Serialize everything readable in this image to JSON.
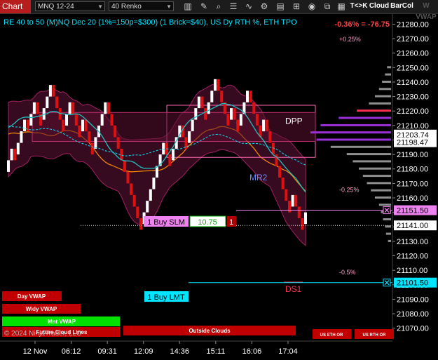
{
  "toolbar": {
    "chart_label": "Chart",
    "instrument": "MNQ 12-24",
    "bar_type": "40 Renko",
    "buttons": [
      "T<>K",
      "Cloud",
      "BarCol",
      "W VWAP"
    ],
    "colors": {
      "chart_tab": "#b81d1d",
      "t_k": "#ff8c00",
      "cloud": "#cc1f1f",
      "barcol": "#ff8c00",
      "wvwap": "#cfcfcf"
    }
  },
  "header": {
    "title": "RE 40 to 50 (M)NQ Dec 20 (1%=150p=$300) (1 Brick=$40), US Dy RTH %, ETH TPO",
    "change": "-0.36% = -76.75"
  },
  "price_axis": {
    "ticks": [
      "21280.00",
      "21270.00",
      "21260.00",
      "21250.00",
      "21240.00",
      "21230.00",
      "21220.00",
      "21210.00",
      "21200.00",
      "21190.00",
      "21180.00",
      "21170.00",
      "21160.00",
      "21150.00",
      "21140.00",
      "21130.00",
      "21120.00",
      "21110.00",
      "21100.00",
      "21090.00",
      "21080.00",
      "21070.00"
    ],
    "tags": [
      {
        "value": "21203.74",
        "price": 21203.74,
        "bg": "#ffffff",
        "fg": "#000000"
      },
      {
        "value": "21198.47",
        "price": 21198.47,
        "bg": "#ffffff",
        "fg": "#000000"
      },
      {
        "value": "21151.50",
        "price": 21151.5,
        "bg": "#ee82ee",
        "fg": "#000000"
      },
      {
        "value": "21141.00",
        "price": 21141.0,
        "bg": "#ffffff",
        "fg": "#000000"
      },
      {
        "value": "21101.50",
        "price": 21101.5,
        "bg": "#00e5ff",
        "fg": "#000000"
      }
    ]
  },
  "time_axis": {
    "labels": [
      "12 Nov",
      "06:12",
      "09:31",
      "12:09",
      "14:36",
      "15:11",
      "16:06",
      "17:04"
    ]
  },
  "chart_data": {
    "type": "candlestick",
    "instrument": "MNQ 12-24",
    "bar_type": "40 Renko",
    "y_range": [
      21065,
      21287
    ],
    "bricks": [
      [
        "u",
        21178,
        21186
      ],
      [
        "u",
        21186,
        21194
      ],
      [
        "d",
        21194,
        21186
      ],
      [
        "u",
        21190,
        21198
      ],
      [
        "u",
        21198,
        21206
      ],
      [
        "u",
        21206,
        21214
      ],
      [
        "d",
        21214,
        21206
      ],
      [
        "u",
        21210,
        21218
      ],
      [
        "u",
        21218,
        21226
      ],
      [
        "d",
        21226,
        21218
      ],
      [
        "d",
        21218,
        21210
      ],
      [
        "u",
        21214,
        21222
      ],
      [
        "u",
        21222,
        21230
      ],
      [
        "u",
        21230,
        21238
      ],
      [
        "d",
        21238,
        21230
      ],
      [
        "d",
        21230,
        21222
      ],
      [
        "d",
        21222,
        21214
      ],
      [
        "d",
        21214,
        21206
      ],
      [
        "u",
        21210,
        21218
      ],
      [
        "u",
        21218,
        21226
      ],
      [
        "d",
        21226,
        21218
      ],
      [
        "d",
        21218,
        21210
      ],
      [
        "d",
        21210,
        21202
      ],
      [
        "u",
        21206,
        21214
      ],
      [
        "d",
        21214,
        21206
      ],
      [
        "d",
        21206,
        21198
      ],
      [
        "d",
        21198,
        21190
      ],
      [
        "u",
        21194,
        21202
      ],
      [
        "u",
        21202,
        21210
      ],
      [
        "u",
        21210,
        21218
      ],
      [
        "u",
        21218,
        21226
      ],
      [
        "d",
        21226,
        21218
      ],
      [
        "d",
        21218,
        21210
      ],
      [
        "d",
        21210,
        21202
      ],
      [
        "d",
        21202,
        21194
      ],
      [
        "d",
        21194,
        21186
      ],
      [
        "d",
        21186,
        21178
      ],
      [
        "d",
        21178,
        21170
      ],
      [
        "d",
        21170,
        21162
      ],
      [
        "d",
        21162,
        21154
      ],
      [
        "d",
        21154,
        21146
      ],
      [
        "d",
        21146,
        21138
      ],
      [
        "u",
        21142,
        21150
      ],
      [
        "u",
        21150,
        21158
      ],
      [
        "u",
        21158,
        21166
      ],
      [
        "u",
        21166,
        21174
      ],
      [
        "u",
        21174,
        21182
      ],
      [
        "u",
        21182,
        21190
      ],
      [
        "u",
        21190,
        21198
      ],
      [
        "d",
        21198,
        21190
      ],
      [
        "d",
        21190,
        21182
      ],
      [
        "u",
        21186,
        21194
      ],
      [
        "u",
        21194,
        21202
      ],
      [
        "u",
        21202,
        21210
      ],
      [
        "d",
        21210,
        21202
      ],
      [
        "d",
        21202,
        21194
      ],
      [
        "u",
        21198,
        21206
      ],
      [
        "u",
        21206,
        21214
      ],
      [
        "u",
        21214,
        21222
      ],
      [
        "u",
        21222,
        21230
      ],
      [
        "d",
        21230,
        21222
      ],
      [
        "d",
        21222,
        21214
      ],
      [
        "u",
        21218,
        21226
      ],
      [
        "u",
        21226,
        21234
      ],
      [
        "u",
        21234,
        21242
      ],
      [
        "d",
        21242,
        21234
      ],
      [
        "d",
        21234,
        21226
      ],
      [
        "d",
        21226,
        21218
      ],
      [
        "d",
        21218,
        21210
      ],
      [
        "u",
        21214,
        21222
      ],
      [
        "d",
        21222,
        21214
      ],
      [
        "d",
        21214,
        21206
      ],
      [
        "u",
        21210,
        21218
      ],
      [
        "u",
        21218,
        21226
      ],
      [
        "u",
        21226,
        21234
      ],
      [
        "d",
        21234,
        21226
      ],
      [
        "d",
        21226,
        21218
      ],
      [
        "d",
        21218,
        21210
      ],
      [
        "d",
        21210,
        21202
      ],
      [
        "u",
        21206,
        21214
      ],
      [
        "d",
        21214,
        21206
      ],
      [
        "d",
        21206,
        21198
      ],
      [
        "d",
        21198,
        21190
      ],
      [
        "d",
        21190,
        21182
      ],
      [
        "d",
        21182,
        21174
      ],
      [
        "d",
        21174,
        21166
      ],
      [
        "d",
        21166,
        21158
      ],
      [
        "d",
        21158,
        21150
      ],
      [
        "u",
        21154,
        21162
      ],
      [
        "d",
        21162,
        21154
      ],
      [
        "d",
        21154,
        21146
      ],
      [
        "d",
        21146,
        21138
      ],
      [
        "u",
        21142,
        21150
      ]
    ],
    "levels": {
      "dpp": {
        "label": "DPP",
        "price": 21213
      },
      "mr2": {
        "label": "MR2",
        "price": 21174
      },
      "ds1": {
        "label": "DS1",
        "price": 21097
      },
      "pct_plus_025": {
        "label": "+0.25%",
        "price": 21270
      },
      "pct_minus_025": {
        "label": "-0.25%",
        "price": 21166
      },
      "pct_minus_05": {
        "label": "-0.5%",
        "price": 21109
      },
      "last_price_dotted": {
        "price": 21141
      }
    },
    "volume_profile": [
      [
        21250,
        4
      ],
      [
        21245,
        6
      ],
      [
        21240,
        9
      ],
      [
        21235,
        12
      ],
      [
        21230,
        16
      ],
      [
        21225,
        22
      ],
      [
        21220,
        34
      ],
      [
        21215,
        52
      ],
      [
        21210,
        70
      ],
      [
        21205,
        80
      ],
      [
        21200,
        74
      ],
      [
        21195,
        60
      ],
      [
        21190,
        44
      ],
      [
        21185,
        38
      ],
      [
        21180,
        32
      ],
      [
        21175,
        28
      ],
      [
        21170,
        24
      ],
      [
        21165,
        20
      ],
      [
        21160,
        16
      ],
      [
        21155,
        12
      ],
      [
        21150,
        10
      ],
      [
        21145,
        8
      ],
      [
        21140,
        6
      ],
      [
        21135,
        5
      ],
      [
        21130,
        3
      ]
    ]
  },
  "orders": {
    "buy_slm": {
      "label": "1 Buy SLM",
      "price_text": "10.75",
      "qty": "1",
      "price": 21151.5
    },
    "buy_lmt": {
      "label": "1 Buy LMT",
      "price": 21101.5
    }
  },
  "legend": {
    "day_vwap": "Day VWAP",
    "wkly_vwap": "Wkly VWAP",
    "mnt_vwap": "Mnt VWAP",
    "future_cloud_lines": "Future Cloud Lines",
    "outside_clouds": "Outside Clouds",
    "us_eth_or": "US ETH OR",
    "us_rth_or": "US RTH OR",
    "copyright": "© 2024 NinjaTrader, LLC"
  }
}
